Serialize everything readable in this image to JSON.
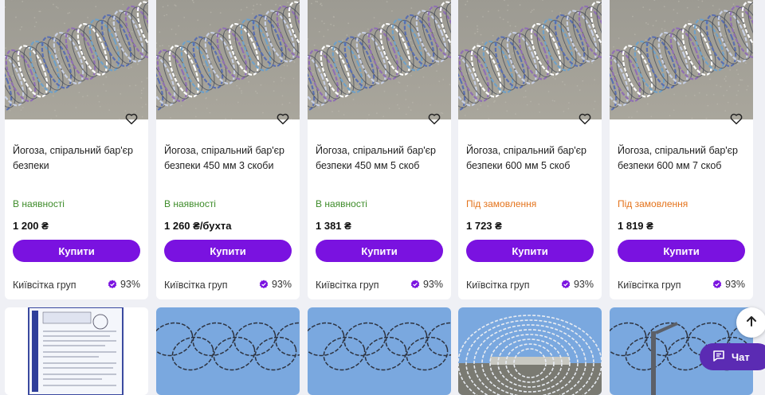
{
  "colors": {
    "page_bg": "#eff0f5",
    "buy_button": "#7a12e0",
    "in_stock": "#3e8c2a",
    "on_order": "#e4731b",
    "chat_button": "#5b2bb3"
  },
  "products": [
    {
      "title": "Йогоза, спіральний бар'єр безпеки",
      "status": "В наявності",
      "status_kind": "in",
      "price": "1 200 ₴",
      "buy_label": "Купити",
      "seller": "Київсітка груп",
      "rating": "93%",
      "favorite_icon": "heart-outline-icon"
    },
    {
      "title": "Йогоза, спіральний бар'єр безпеки 450 мм 3 скоби",
      "status": "В наявності",
      "status_kind": "in",
      "price": "1 260 ₴/бухта",
      "buy_label": "Купити",
      "seller": "Київсітка груп",
      "rating": "93%",
      "favorite_icon": "heart-outline-icon"
    },
    {
      "title": "Йогоза, спіральний бар'єр безпеки 450 мм 5 скоб",
      "status": "В наявності",
      "status_kind": "in",
      "price": "1 381 ₴",
      "buy_label": "Купити",
      "seller": "Київсітка груп",
      "rating": "93%",
      "favorite_icon": "heart-outline-icon"
    },
    {
      "title": "Йогоза, спіральний бар'єр безпеки 600 мм 5 скоб",
      "status": "Під замовлення",
      "status_kind": "order",
      "price": "1 723 ₴",
      "buy_label": "Купити",
      "seller": "Київсітка груп",
      "rating": "93%",
      "favorite_icon": "heart-outline-icon"
    },
    {
      "title": "Йогоза, спіральний бар'єр безпеки 600 мм 7 скоб",
      "status": "Під замовлення",
      "status_kind": "order",
      "price": "1 819 ₴",
      "buy_label": "Купити",
      "seller": "Київсітка груп",
      "rating": "93%",
      "favorite_icon": "heart-outline-icon"
    }
  ],
  "floating": {
    "scroll_top_icon": "arrow-up-icon",
    "chat_icon": "chat-icon",
    "chat_label": "Чат"
  }
}
